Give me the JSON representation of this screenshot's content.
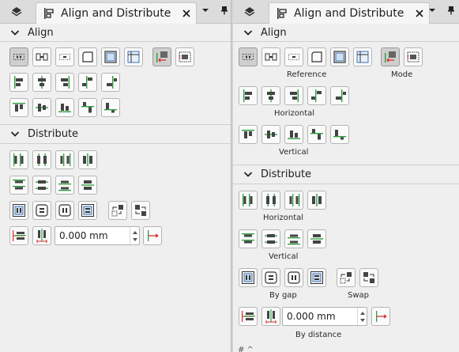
{
  "tab": {
    "label": "Align and Distribute"
  },
  "align": {
    "title": "Align"
  },
  "distribute": {
    "title": "Distribute"
  },
  "captions": {
    "reference": "Reference",
    "mode": "Mode",
    "horizontal": "Horizontal",
    "vertical": "Vertical",
    "by_gap": "By gap",
    "swap": "Swap",
    "by_distance": "By distance"
  },
  "distance": {
    "value": "0.000 mm"
  },
  "bottom_fragment": "# ^",
  "icons": {
    "layers": "layers-icon",
    "align_tab": "align-distribute-icon",
    "close": "close-icon",
    "menu": "chevron-down-icon",
    "pin": "pin-icon"
  },
  "colors": {
    "accent_green": "#2e9e3e",
    "accent_red": "#d62b2b",
    "button_bg": "#fafafa",
    "toggled_bg": "#cfcfcf"
  }
}
